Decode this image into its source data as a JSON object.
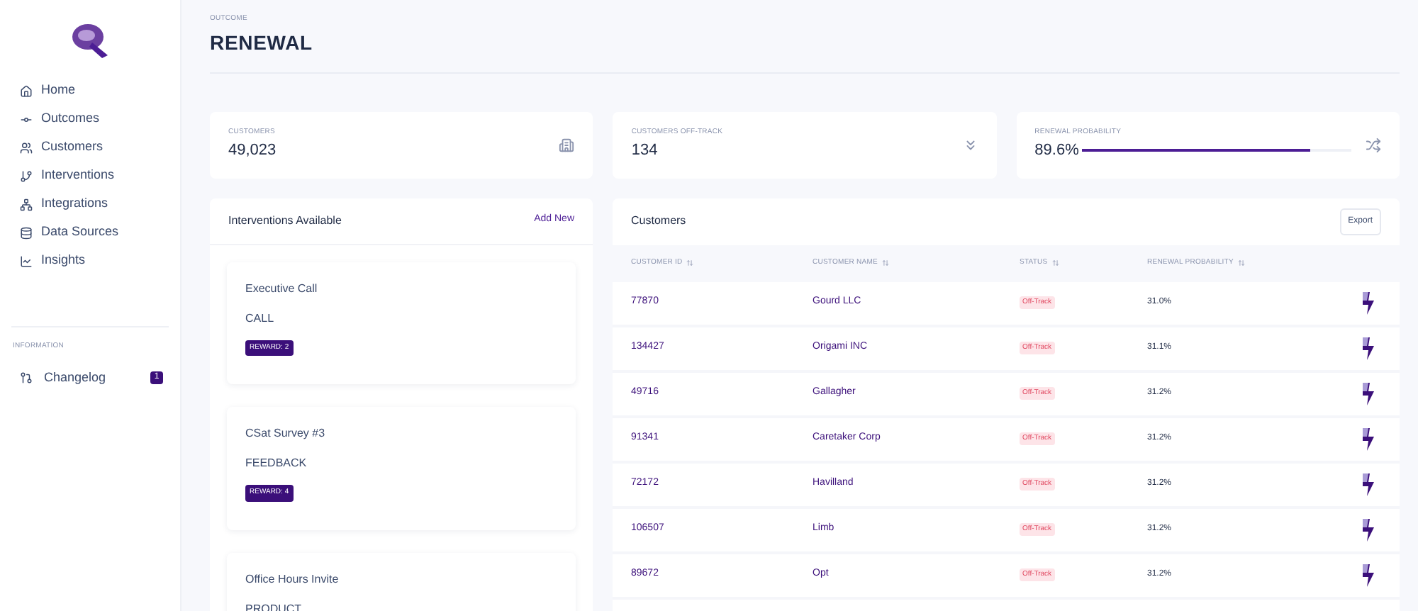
{
  "sidebar": {
    "items": [
      {
        "label": "Home",
        "selected": false
      },
      {
        "label": "Outcomes",
        "selected": false
      },
      {
        "label": "Customers",
        "selected": false
      },
      {
        "label": "Interventions",
        "selected": false
      },
      {
        "label": "Integrations",
        "selected": false
      },
      {
        "label": "Data Sources",
        "selected": false
      },
      {
        "label": "Insights",
        "selected": false
      }
    ],
    "section_title": "INFORMATION",
    "info_items": [
      {
        "label": "Changelog",
        "badge": "1"
      }
    ]
  },
  "header": {
    "eyebrow": "OUTCOME",
    "title": "RENEWAL"
  },
  "stats": [
    {
      "kind": "number",
      "label": "CUSTOMERS",
      "value": "49,023"
    },
    {
      "kind": "number",
      "label": "CUSTOMERS OFF-TRACK",
      "value": "134"
    },
    {
      "kind": "progress",
      "label": "RENEWAL PROBABILITY",
      "value": "89.6%",
      "level": 0.85
    }
  ],
  "interventions": {
    "title": "Interventions Available",
    "action": "Add New",
    "cards": [
      {
        "name": "Executive Call",
        "type": "CALL",
        "badge": "REWARD: 2"
      },
      {
        "name": "CSat Survey #3",
        "type": "FEEDBACK",
        "badge": "REWARD: 4"
      },
      {
        "name": "Office Hours Invite",
        "type": "PRODUCT"
      }
    ]
  },
  "customers": {
    "title": "Customers",
    "action": "Export",
    "columns": [
      "CUSTOMER ID",
      "CUSTOMER NAME",
      "STATUS",
      "RENEWAL PROBABILITY"
    ],
    "rows": [
      {
        "id": "77870",
        "name": "Gourd LLC",
        "status": "Off-Track",
        "probability": "31.0%"
      },
      {
        "id": "134427",
        "name": "Origami INC",
        "status": "Off-Track",
        "probability": "31.1%"
      },
      {
        "id": "49716",
        "name": "Gallagher",
        "status": "Off-Track",
        "probability": "31.2%"
      },
      {
        "id": "91341",
        "name": "Caretaker Corp",
        "status": "Off-Track",
        "probability": "31.2%"
      },
      {
        "id": "72172",
        "name": "Havilland",
        "status": "Off-Track",
        "probability": "31.2%"
      },
      {
        "id": "106507",
        "name": "Limb",
        "status": "Off-Track",
        "probability": "31.2%"
      },
      {
        "id": "89672",
        "name": "Opt",
        "status": "Off-Track",
        "probability": "31.2%"
      }
    ]
  }
}
